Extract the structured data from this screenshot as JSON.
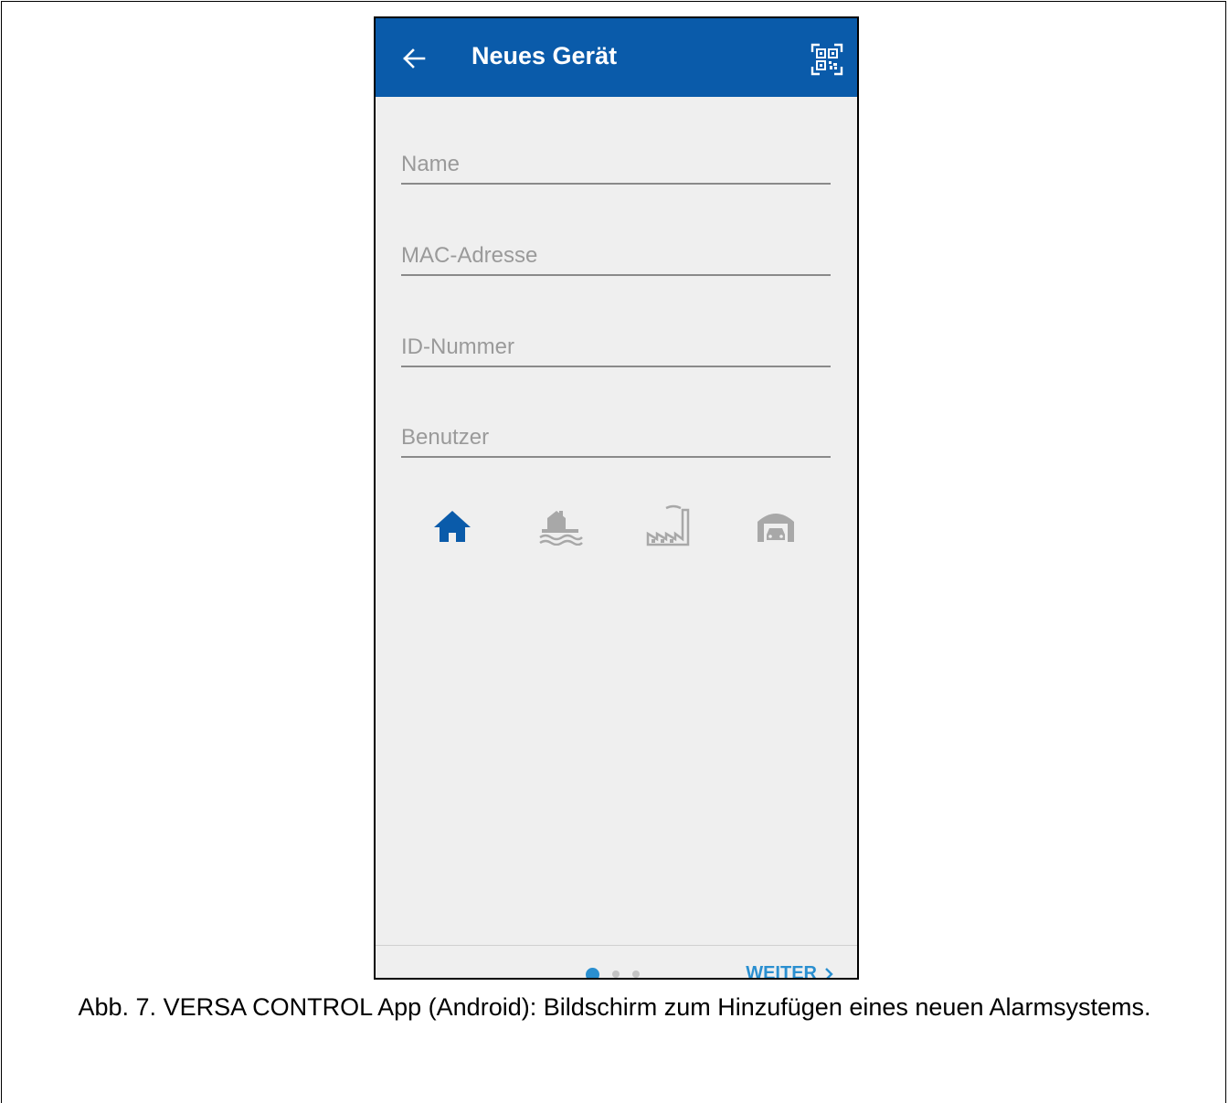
{
  "appbar": {
    "title": "Neues Gerät",
    "back_icon": "arrow-left-icon",
    "scan_icon": "qr-code-scan-icon"
  },
  "form": {
    "name_placeholder": "Name",
    "mac_placeholder": "MAC-Adresse",
    "id_placeholder": "ID-Nummer",
    "user_placeholder": "Benutzer"
  },
  "object_types": [
    {
      "icon": "house-icon",
      "selected": true
    },
    {
      "icon": "house-water-icon",
      "selected": false
    },
    {
      "icon": "factory-icon",
      "selected": false
    },
    {
      "icon": "garage-icon",
      "selected": false
    }
  ],
  "pager": {
    "total_pages": 3,
    "current_page": 1
  },
  "footer": {
    "next_label": "WEITER",
    "next_icon": "chevron-right-icon"
  },
  "caption": {
    "text": "Abb. 7. VERSA CONTROL App (Android): Bildschirm zum Hinzufügen eines neuen Alarmsystems."
  },
  "colors": {
    "appbar": "#0a5baa",
    "accent": "#2a8fd0",
    "selected_icon": "#0a5baa",
    "unselected_icon": "#a8a8a8",
    "screen_bg": "#efefef"
  }
}
